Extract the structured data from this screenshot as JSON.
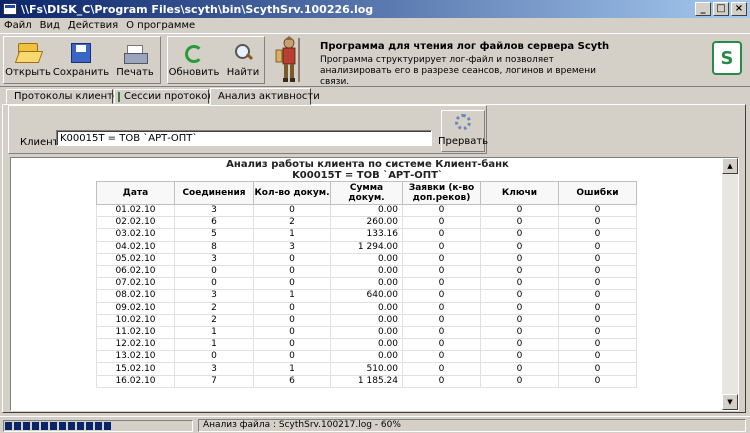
{
  "window": {
    "title": "\\\\Fs\\DISK_C\\Program Files\\scyth\\bin\\ScythSrv.100226.log"
  },
  "menu": [
    "Файл",
    "Вид",
    "Действия",
    "О программе"
  ],
  "toolbar": {
    "open": "Открыть",
    "save": "Сохранить",
    "print": "Печать",
    "refresh": "Обновить",
    "find": "Найти"
  },
  "promo": {
    "title": "Программа для чтения лог файлов сервера Scyth",
    "desc": "Программа структурирует лог-файл и позволяет анализировать его в разрезе сеансов, логинов и времени связи."
  },
  "tabs": [
    "Протоколы клиентов",
    "Сессии протокола",
    "Анализ активности"
  ],
  "client": {
    "label": "Клиент",
    "value": "K00015T = ТОВ `АРТ-ОПТ`",
    "stop": "Прервать"
  },
  "report": {
    "title": "Анализ работы клиента по системе Клиент-банк",
    "subtitle": "K00015T = ТОВ `АРТ-ОПТ`",
    "columns": [
      "Дата",
      "Соединения",
      "Кол-во докум.",
      "Сумма докум.",
      "Заявки (к-во доп.реков)",
      "Ключи",
      "Ошибки"
    ],
    "rows": [
      [
        "01.02.10",
        "3",
        "0",
        "0.00",
        "0",
        "0",
        "0"
      ],
      [
        "02.02.10",
        "6",
        "2",
        "260.00",
        "0",
        "0",
        "0"
      ],
      [
        "03.02.10",
        "5",
        "1",
        "133.16",
        "0",
        "0",
        "0"
      ],
      [
        "04.02.10",
        "8",
        "3",
        "1 294.00",
        "0",
        "0",
        "0"
      ],
      [
        "05.02.10",
        "3",
        "0",
        "0.00",
        "0",
        "0",
        "0"
      ],
      [
        "06.02.10",
        "0",
        "0",
        "0.00",
        "0",
        "0",
        "0"
      ],
      [
        "07.02.10",
        "0",
        "0",
        "0.00",
        "0",
        "0",
        "0"
      ],
      [
        "08.02.10",
        "3",
        "1",
        "640.00",
        "0",
        "0",
        "0"
      ],
      [
        "09.02.10",
        "2",
        "0",
        "0.00",
        "0",
        "0",
        "0"
      ],
      [
        "10.02.10",
        "2",
        "0",
        "0.00",
        "0",
        "0",
        "0"
      ],
      [
        "11.02.10",
        "1",
        "0",
        "0.00",
        "0",
        "0",
        "0"
      ],
      [
        "12.02.10",
        "1",
        "0",
        "0.00",
        "0",
        "0",
        "0"
      ],
      [
        "13.02.10",
        "0",
        "0",
        "0.00",
        "0",
        "0",
        "0"
      ],
      [
        "15.02.10",
        "3",
        "1",
        "510.00",
        "0",
        "0",
        "0"
      ],
      [
        "16.02.10",
        "7",
        "6",
        "1 185.24",
        "0",
        "0",
        "0"
      ]
    ]
  },
  "status": {
    "text": "Анализ файла : ScythSrv.100217.log  -  60%",
    "progress_percent": 60
  }
}
